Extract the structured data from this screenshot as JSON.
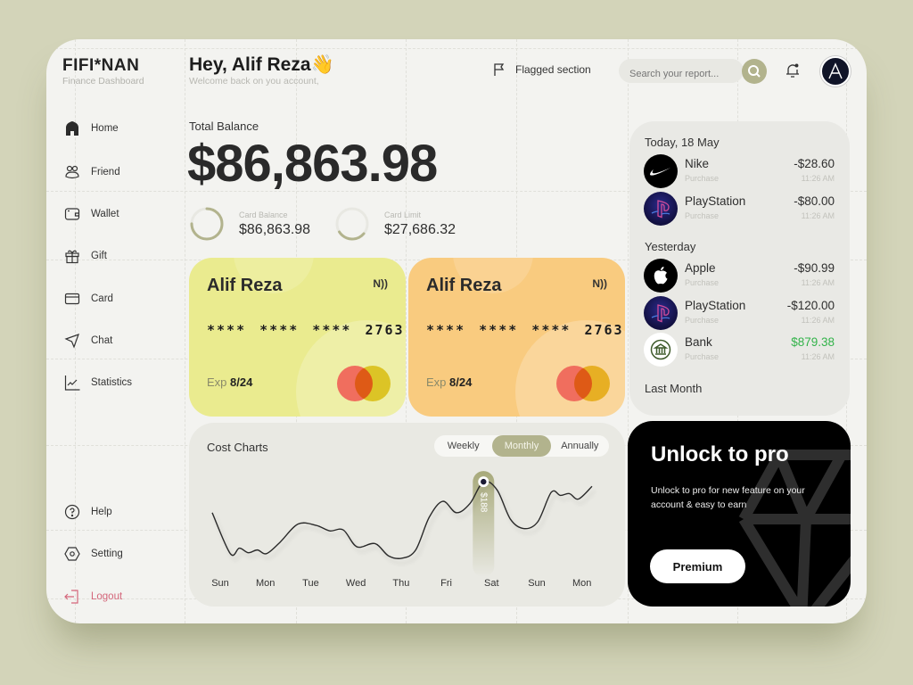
{
  "brand": {
    "title": "FIFI*NAN",
    "subtitle": "Finance Dashboard"
  },
  "header": {
    "greeting": "Hey, Alif Reza👋",
    "welcome": "Welcome back on you account,",
    "flagged_label": "Flagged section",
    "search_placeholder": "Search your report...",
    "avatar_letter": "A"
  },
  "sidebar": {
    "items": [
      {
        "label": "Home",
        "icon": "home-icon",
        "active": true
      },
      {
        "label": "Friend",
        "icon": "friends-icon"
      },
      {
        "label": "Wallet",
        "icon": "wallet-icon"
      },
      {
        "label": "Gift",
        "icon": "gift-icon"
      },
      {
        "label": "Card",
        "icon": "card-icon"
      },
      {
        "label": "Chat",
        "icon": "send-icon"
      },
      {
        "label": "Statistics",
        "icon": "chart-icon"
      }
    ],
    "bottom": [
      {
        "label": "Help",
        "icon": "help-icon"
      },
      {
        "label": "Setting",
        "icon": "settings-icon"
      },
      {
        "label": "Logout",
        "icon": "logout-icon"
      }
    ]
  },
  "balance": {
    "label": "Total Balance",
    "value": "$86,863.98",
    "card_balance_label": "Card Balance",
    "card_balance_value": "$86,863.98",
    "card_balance_progress": 0.75,
    "card_limit_label": "Card Limit",
    "card_limit_value": "$27,686.32",
    "card_limit_progress": 0.3
  },
  "cards": [
    {
      "holder": "Alif Reza",
      "number": "**** **** **** 2763",
      "exp_label": "Exp",
      "exp": "8/24",
      "nfc": "N))",
      "color": "#eaeb8f"
    },
    {
      "holder": "Alif Reza",
      "number": "**** **** **** 2763",
      "exp_label": "Exp",
      "exp": "8/24",
      "nfc": "N))",
      "color": "#f9cb7f"
    }
  ],
  "cost_chart": {
    "title": "Cost Charts",
    "tabs": [
      "Weekly",
      "Monthly",
      "Annually"
    ],
    "active_tab": "Monthly",
    "tooltip": "$188"
  },
  "chart_data": {
    "type": "line",
    "title": "Cost Charts",
    "categories": [
      "Sun",
      "Mon",
      "Tue",
      "Wed",
      "Thu",
      "Fri",
      "Sat",
      "Sun",
      "Mon"
    ],
    "x": [
      0,
      0.4,
      0.6,
      0.8,
      1.0,
      1.2,
      1.5,
      1.9,
      2.3,
      2.6,
      2.9,
      3.2,
      3.6,
      3.9,
      4.2,
      4.5,
      4.8,
      5.1,
      5.4,
      5.7,
      6.0,
      6.3,
      6.6,
      6.9,
      7.2,
      7.5,
      7.7,
      7.9,
      8.1,
      8.4
    ],
    "values": [
      120,
      30,
      42,
      32,
      38,
      30,
      55,
      95,
      92,
      80,
      82,
      45,
      52,
      25,
      20,
      38,
      110,
      145,
      120,
      140,
      188,
      170,
      105,
      85,
      100,
      165,
      158,
      162,
      150,
      178
    ],
    "highlight": {
      "category": "Sat",
      "value": 188,
      "label": "$188"
    },
    "ylim": [
      0,
      200
    ],
    "xlabel": "",
    "ylabel": "",
    "grid": false,
    "legend": "none"
  },
  "transactions": {
    "groups": [
      {
        "label": "Today, 18 May",
        "items": [
          {
            "name": "Nike",
            "type": "Purchase",
            "amount": "-$28.60",
            "time": "11:26 AM",
            "logo": "nike"
          },
          {
            "name": "PlayStation",
            "type": "Purchase",
            "amount": "-$80.00",
            "time": "11:26 AM",
            "logo": "playstation"
          }
        ]
      },
      {
        "label": "Yesterday",
        "items": [
          {
            "name": "Apple",
            "type": "Purchase",
            "amount": "-$90.99",
            "time": "11:26 AM",
            "logo": "apple"
          },
          {
            "name": "PlayStation",
            "type": "Purchase",
            "amount": "-$120.00",
            "time": "11:26 AM",
            "logo": "playstation"
          },
          {
            "name": "Bank",
            "type": "Purchase",
            "amount": "$879.38",
            "time": "11:26 AM",
            "logo": "bank",
            "positive": true
          }
        ]
      },
      {
        "label": "Last Month",
        "items": []
      }
    ]
  },
  "pro": {
    "title": "Unlock to pro",
    "text": "Unlock to pro for new feature on your account & easy to earn",
    "button": "Premium"
  },
  "colors": {
    "background": "#d3d4b9",
    "accent": "#b2b38d",
    "positive": "#33b34a",
    "logout": "#d4667a"
  }
}
